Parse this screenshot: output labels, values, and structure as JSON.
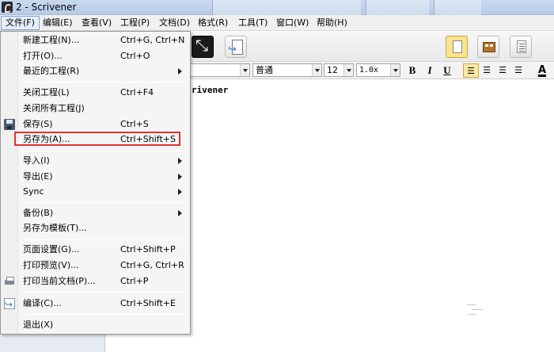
{
  "window": {
    "title": "2 - Scrivener"
  },
  "menubar": [
    {
      "label": "文件(F)",
      "active": true
    },
    {
      "label": "编辑(E)"
    },
    {
      "label": "查看(V)"
    },
    {
      "label": "工程(P)"
    },
    {
      "label": "文档(D)"
    },
    {
      "label": "格式(R)"
    },
    {
      "label": "工具(T)"
    },
    {
      "label": "窗口(W)"
    },
    {
      "label": "帮助(H)"
    }
  ],
  "formatbar": {
    "style": "普通",
    "size": "12",
    "spacing": "1.0x",
    "bold": "B",
    "italic": "I",
    "underline": "U",
    "text_color": "A"
  },
  "editor": {
    "visible_text": "rivener"
  },
  "file_menu": {
    "items": [
      {
        "label": "新建工程(N)...",
        "shortcut": "Ctrl+G, Ctrl+N"
      },
      {
        "label": "打开(O)...",
        "shortcut": "Ctrl+O"
      },
      {
        "label": "最近的工程(R)",
        "submenu": true
      },
      {
        "label": "关闭工程(L)",
        "shortcut": "Ctrl+F4"
      },
      {
        "label": "关闭所有工程(J)"
      },
      {
        "label": "保存(S)",
        "shortcut": "Ctrl+S",
        "icon": "save-icon"
      },
      {
        "label": "另存为(A)...",
        "shortcut": "Ctrl+Shift+S",
        "highlighted": true
      },
      {
        "label": "导入(I)",
        "submenu": true
      },
      {
        "label": "导出(E)",
        "submenu": true
      },
      {
        "label": "Sync",
        "submenu": true
      },
      {
        "label": "备份(B)",
        "submenu": true
      },
      {
        "label": "另存为模板(T)..."
      },
      {
        "label": "页面设置(G)...",
        "shortcut": "Ctrl+Shift+P"
      },
      {
        "label": "打印预览(V)...",
        "shortcut": "Ctrl+G, Ctrl+R"
      },
      {
        "label": "打印当前文档(P)...",
        "shortcut": "Ctrl+P",
        "icon": "printer-icon"
      },
      {
        "label": "编译(C)...",
        "shortcut": "Ctrl+Shift+E",
        "icon": "compile-icon"
      },
      {
        "label": "退出(X)"
      }
    ]
  },
  "colors": {
    "highlight_border": "#e0332b",
    "toolbar_selected": "#fbe38f"
  }
}
